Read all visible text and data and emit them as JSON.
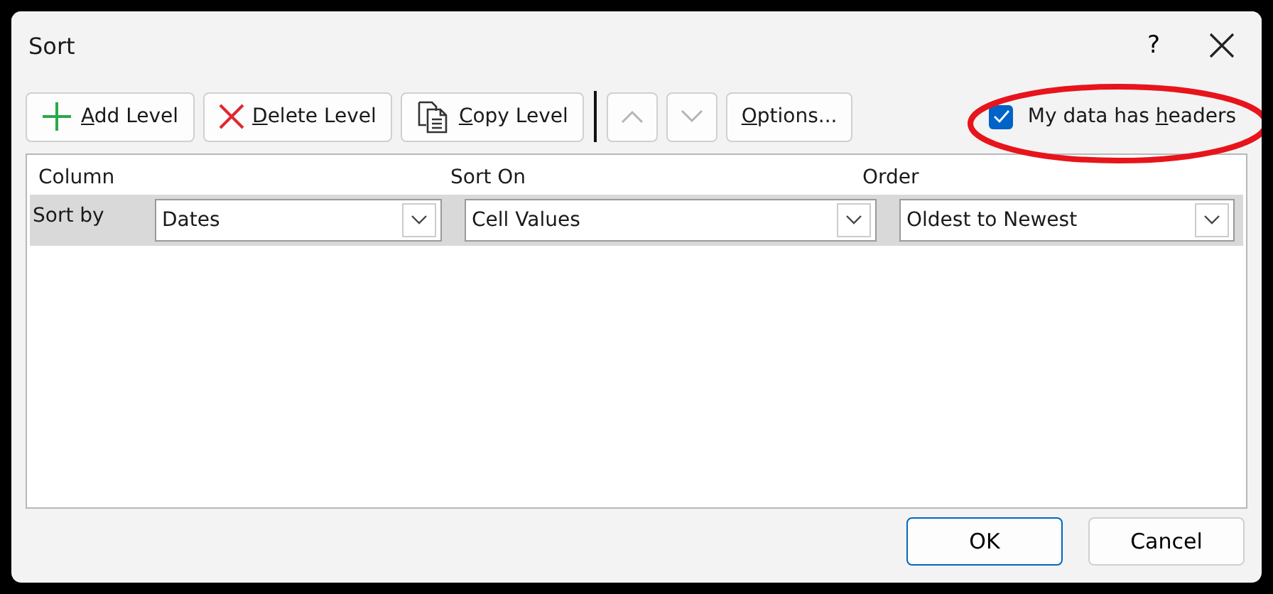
{
  "window": {
    "title": "Sort",
    "help_label": "?"
  },
  "toolbar": [
    {
      "kind": "add",
      "key": "A",
      "after": "dd Level",
      "disabled": false
    },
    {
      "kind": "delete",
      "key": "D",
      "after": "elete Level",
      "disabled": false
    },
    {
      "kind": "copy",
      "key": "C",
      "after": "opy Level",
      "disabled": false
    },
    {
      "kind": "up",
      "disabled": true
    },
    {
      "kind": "down",
      "disabled": true
    },
    {
      "kind": "text",
      "key": "O",
      "after": "ptions...",
      "disabled": false
    }
  ],
  "headers_option": {
    "before": "My data has ",
    "key": "h",
    "after": "eaders",
    "checked": true,
    "highlighted": true
  },
  "table": {
    "columns": [
      "Column",
      "Sort On",
      "Order"
    ],
    "rows": [
      {
        "label": "Sort by",
        "selected": true,
        "column": "Dates",
        "sort_on": "Cell Values",
        "order": "Oldest to Newest"
      }
    ]
  },
  "buttons": [
    {
      "label": "OK",
      "default": true
    },
    {
      "label": "Cancel",
      "default": false
    }
  ]
}
